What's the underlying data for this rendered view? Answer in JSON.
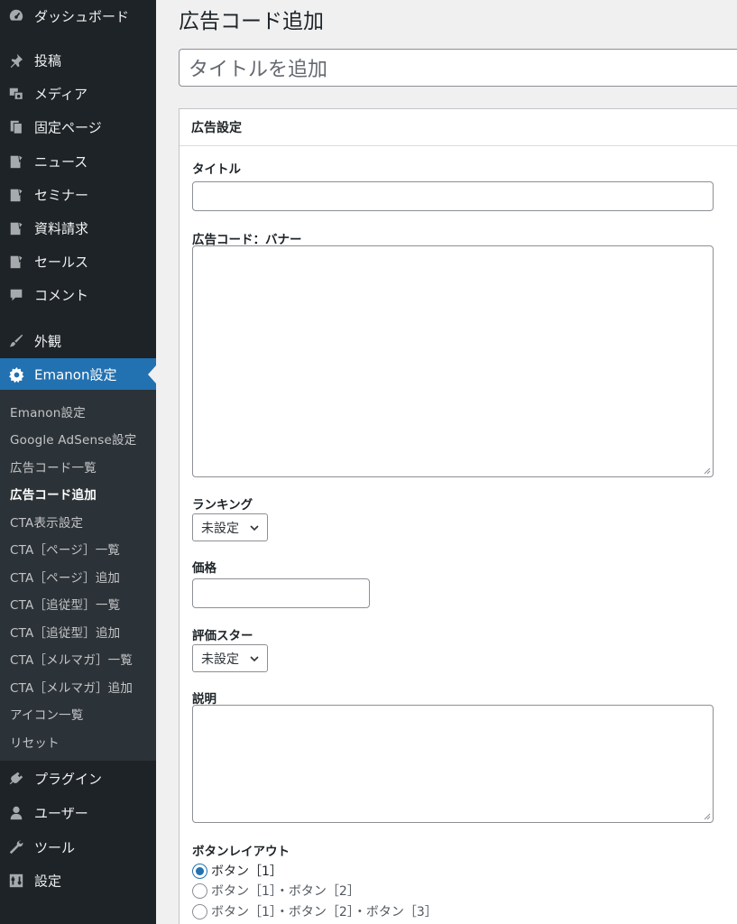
{
  "sidebar": {
    "menu": [
      {
        "label": "ダッシュボード",
        "icon": "dashboard-icon"
      },
      {
        "label": "投稿",
        "icon": "pin-icon"
      },
      {
        "label": "メディア",
        "icon": "media-icon"
      },
      {
        "label": "固定ページ",
        "icon": "pages-icon"
      },
      {
        "label": "ニュース",
        "icon": "post-icon"
      },
      {
        "label": "セミナー",
        "icon": "post-icon"
      },
      {
        "label": "資料請求",
        "icon": "post-icon"
      },
      {
        "label": "セールス",
        "icon": "post-icon"
      },
      {
        "label": "コメント",
        "icon": "comment-icon"
      },
      {
        "label": "外観",
        "icon": "brush-icon"
      },
      {
        "label": "Emanon設定",
        "icon": "gear-icon"
      },
      {
        "label": "プラグイン",
        "icon": "plugin-icon"
      },
      {
        "label": "ユーザー",
        "icon": "user-icon"
      },
      {
        "label": "ツール",
        "icon": "wrench-icon"
      },
      {
        "label": "設定",
        "icon": "settings-icon"
      }
    ],
    "submenu": [
      "Emanon設定",
      "Google AdSense設定",
      "広告コード一覧",
      "広告コード追加",
      "CTA表示設定",
      "CTA［ページ］一覧",
      "CTA［ページ］追加",
      "CTA［追従型］一覧",
      "CTA［追従型］追加",
      "CTA［メルマガ］一覧",
      "CTA［メルマガ］追加",
      "アイコン一覧",
      "リセット"
    ]
  },
  "page": {
    "title": "広告コード追加",
    "title_placeholder": "タイトルを追加"
  },
  "metabox": {
    "heading": "広告設定",
    "fields": {
      "title_label": "タイトル",
      "banner_label": "広告コード：バナー",
      "ranking_label": "ランキング",
      "ranking_value": "未設定",
      "price_label": "価格",
      "rating_label": "評価スター",
      "rating_value": "未設定",
      "description_label": "説明",
      "button_layout_label": "ボタンレイアウト"
    },
    "button_layouts": [
      {
        "label": "ボタン［1］",
        "checked": true
      },
      {
        "label": "ボタン［1］・ボタン［2］",
        "checked": false
      },
      {
        "label": "ボタン［1］・ボタン［2］・ボタン［3］",
        "checked": false
      }
    ]
  },
  "colors": {
    "accent": "#2271b1",
    "sidebar_bg": "#1d2327",
    "submenu_bg": "#2c3338"
  }
}
